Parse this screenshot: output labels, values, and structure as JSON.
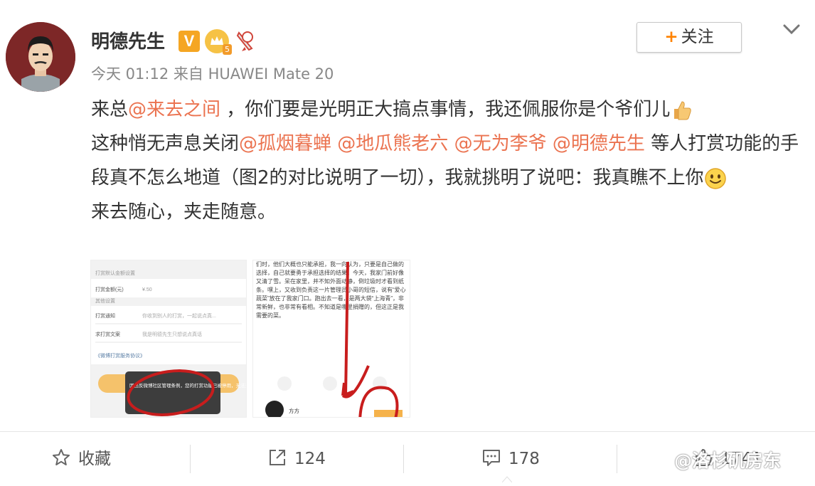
{
  "author": {
    "name": "明德先生",
    "verified_badge": "V",
    "time": "今天 01:12",
    "source_prefix": "来自",
    "device": "HUAWEI Mate 20"
  },
  "follow_button": {
    "plus": "+",
    "label": "关注"
  },
  "post": {
    "line1_prefix": "来总",
    "line1_mention": "@来去之间",
    "line1_suffix": " ，你们要是光明正大搞点事情，我还佩服你是个爷们儿",
    "line2_prefix": "这种悄无声息关闭",
    "mention_a": "@孤烟暮蝉",
    "mention_b": "@地瓜熊老六",
    "mention_c": "@无为李爷",
    "mention_d": "@明德先生",
    "line2_suffix": " 等人打赏功能的手段真不怎么地道（图2的对比说明了一切），我就挑明了说吧：我真瞧不上你",
    "line3": "来去随心，夹走随意。"
  },
  "image1": {
    "row_settings": "打赏默认金额设置",
    "row_amount_label": "打赏金额(元)",
    "row_amount_value": "¥.50",
    "row_other": "其他设置",
    "row_notify_label": "打赏通知",
    "row_notify_value": "你收到别人的打赏，一起说点真...",
    "row_text_label": "求打赏文案",
    "row_text_value": "我是明德先生只想说点真话",
    "link": "《微博打赏服务协议》",
    "toast": "因违反微博社区管理条例，您的打赏功能已被停用，无法开启"
  },
  "image2": {
    "text": "们时，他们大概也只能承担，我一向认为，只要是自己做的选择，自己就要勇于承担选择的结果。今天，我家门前好像又清了雪。呆在家里，并不知外面动静，倒垃圾时才看到纸条。嘿上，又收到负责这一片管理员小哥的短信，说有“爱心蔬菜”放在了我家门口。跑出去一看，是两大袋“上海青”，非常新鲜，也非常有看相。不知道是哪里捐赠的，但这正是我需要的菜。",
    "commenter": "方方"
  },
  "actions": {
    "favorite": "收藏",
    "repost_count": "124",
    "comment_count": "178",
    "like_count": "1741"
  },
  "watermark": "@洛杉矶房东",
  "colors": {
    "mention": "#eb7350",
    "accent": "#ff8200",
    "badge": "#f5a623"
  },
  "icons": [
    "star-icon",
    "repost-icon",
    "comment-icon",
    "like-icon",
    "chevron-down-icon",
    "thumbs-up-emoji",
    "smile-emoji"
  ]
}
